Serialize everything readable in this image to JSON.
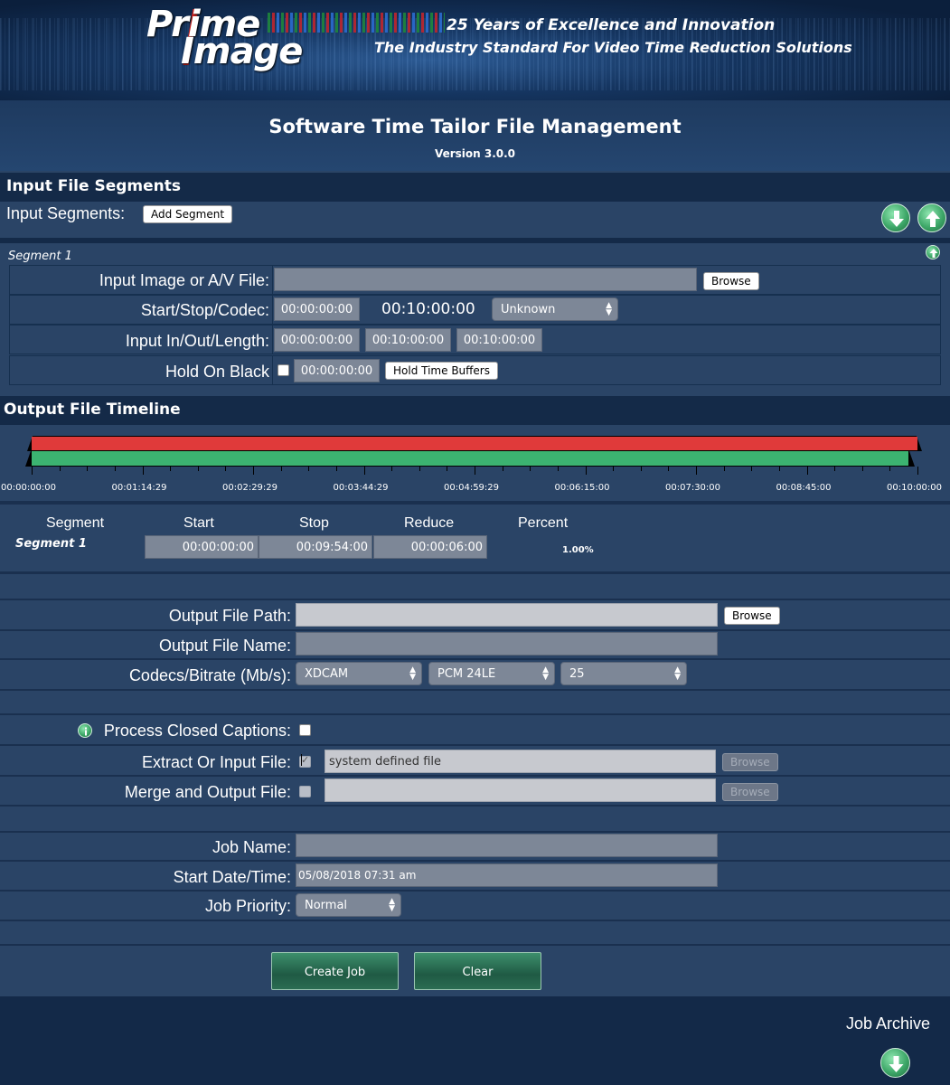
{
  "banner": {
    "logo_line1": "Prime",
    "logo_line2": "Image",
    "tagline1": "25 Years of Excellence and Innovation",
    "tagline2": "The Industry Standard For Video Time Reduction Solutions"
  },
  "header": {
    "title": "Software Time Tailor File Management",
    "version": "Version 3.0.0"
  },
  "input_section": {
    "title": "Input File Segments",
    "segments_label": "Input Segments:",
    "add_segment_label": "Add Segment",
    "segment_title": "Segment 1",
    "file_label": "Input Image or A/V File:",
    "file_value": "",
    "browse_label": "Browse",
    "start_stop_label": "Start/Stop/Codec:",
    "start_value": "00:00:00:00",
    "stop_value": "00:10:00:00",
    "codec_value": "Unknown",
    "inout_label": "Input In/Out/Length:",
    "in_value": "00:00:00:00",
    "out_value": "00:10:00:00",
    "length_value": "00:10:00:00",
    "hold_label": "Hold On Black",
    "hold_value": "00:00:00:00",
    "hold_button_label": "Hold Time Buffers"
  },
  "timeline": {
    "title": "Output File Timeline",
    "ticks": [
      "00:00:00:00",
      "00:01:14:29",
      "00:02:29:29",
      "00:03:44:29",
      "00:04:59:29",
      "00:06:15:00",
      "00:07:30:00",
      "00:08:45:00",
      "00:10:00:00"
    ],
    "columns": [
      "Segment",
      "Start",
      "Stop",
      "Reduce",
      "Percent"
    ],
    "row": {
      "segment": "Segment 1",
      "start": "00:00:00:00",
      "stop": "00:09:54:00",
      "reduce": "00:00:06:00",
      "percent": "1.00%"
    },
    "bar_colors": {
      "input": "#e03a3a",
      "output": "#3cb371"
    }
  },
  "output": {
    "path_label": "Output File Path:",
    "path_value": "",
    "browse_label": "Browse",
    "name_label": "Output File Name:",
    "name_value": "",
    "codecs_label": "Codecs/Bitrate (Mb/s):",
    "video_codec": "XDCAM",
    "audio_codec": "PCM 24LE",
    "bitrate": "25"
  },
  "captions": {
    "process_label": "Process Closed Captions:",
    "extract_label": "Extract Or Input File:",
    "extract_value": "system defined file",
    "extract_browse": "Browse",
    "merge_label": "Merge and Output File:",
    "merge_value": "",
    "merge_browse": "Browse"
  },
  "job": {
    "name_label": "Job Name:",
    "name_value": "",
    "date_label": "Start Date/Time:",
    "date_value": "05/08/2018 07:31 am",
    "priority_label": "Job Priority:",
    "priority_value": "Normal",
    "create_label": "Create Job",
    "clear_label": "Clear"
  },
  "archive": {
    "label": "Job Archive"
  },
  "colors": {
    "page_bg": "#2a4466",
    "section_head_bg": "#142a48",
    "accent_green": "#3ea869"
  }
}
